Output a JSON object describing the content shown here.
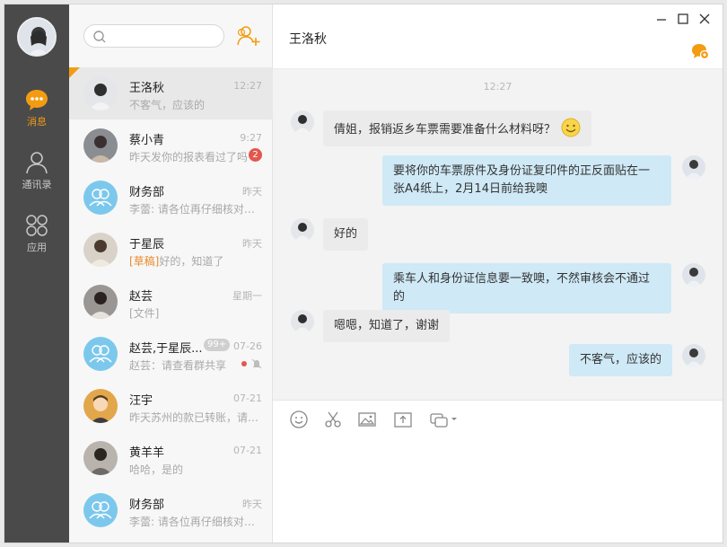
{
  "colors": {
    "accent": "#f39c12",
    "rail": "#4a4a4a",
    "outgoing_bubble": "#cfe9f6",
    "badge": "#e2574c"
  },
  "rail": {
    "items": [
      {
        "label": "消息",
        "icon": "chat-bubble-icon",
        "active": true
      },
      {
        "label": "通讯录",
        "icon": "contacts-icon",
        "active": false
      },
      {
        "label": "应用",
        "icon": "apps-icon",
        "active": false
      }
    ]
  },
  "search": {
    "placeholder": ""
  },
  "conversations": [
    {
      "name": "王洛秋",
      "time": "12:27",
      "preview": "不客气，应该的"
    },
    {
      "name": "蔡小青",
      "time": "9:27",
      "preview": "昨天发你的报表看过了吗",
      "badge": "2"
    },
    {
      "name": "财务部",
      "time": "昨天",
      "preview": "李蕾: 请各位再仔细核对一下"
    },
    {
      "name": "于星辰",
      "time": "昨天",
      "draft": "[草稿]",
      "preview": "好的，知道了"
    },
    {
      "name": "赵芸",
      "time": "星期一",
      "preview": "[文件]"
    },
    {
      "name": "赵芸,于星辰...",
      "time": "07-26",
      "preview": "赵芸：请查看群共享",
      "badge": "99+"
    },
    {
      "name": "汪宇",
      "time": "07-21",
      "preview": "昨天苏州的款已转账，请查收"
    },
    {
      "name": "黄羊羊",
      "time": "07-21",
      "preview": "哈哈，是的"
    },
    {
      "name": "财务部",
      "time": "昨天",
      "preview": "李蕾: 请各位再仔细核对一下"
    }
  ],
  "chat": {
    "title": "王洛秋",
    "time_divider": "12:27",
    "messages": [
      {
        "dir": "in",
        "text": "倩姐，报销返乡车票需要准备什么材料呀？"
      },
      {
        "dir": "out",
        "text": "要将你的车票原件及身份证复印件的正反面贴在一张A4纸上，2月14日前给我噢"
      },
      {
        "dir": "in",
        "text": "好的"
      },
      {
        "dir": "out",
        "text": "乘车人和身份证信息要一致噢，不然审核会不通过的"
      },
      {
        "dir": "in",
        "text": "嗯嗯，知道了，谢谢"
      },
      {
        "dir": "out",
        "text": "不客气，应该的"
      }
    ]
  }
}
